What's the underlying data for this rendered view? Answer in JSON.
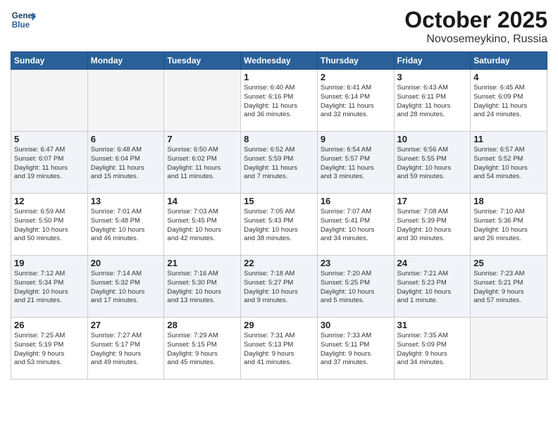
{
  "header": {
    "logo_line1": "General",
    "logo_line2": "Blue",
    "month": "October 2025",
    "location": "Novosemeykino, Russia"
  },
  "weekdays": [
    "Sunday",
    "Monday",
    "Tuesday",
    "Wednesday",
    "Thursday",
    "Friday",
    "Saturday"
  ],
  "weeks": [
    {
      "shaded": false,
      "days": [
        {
          "num": "",
          "info": ""
        },
        {
          "num": "",
          "info": ""
        },
        {
          "num": "",
          "info": ""
        },
        {
          "num": "1",
          "info": "Sunrise: 6:40 AM\nSunset: 6:16 PM\nDaylight: 11 hours\nand 36 minutes."
        },
        {
          "num": "2",
          "info": "Sunrise: 6:41 AM\nSunset: 6:14 PM\nDaylight: 11 hours\nand 32 minutes."
        },
        {
          "num": "3",
          "info": "Sunrise: 6:43 AM\nSunset: 6:11 PM\nDaylight: 11 hours\nand 28 minutes."
        },
        {
          "num": "4",
          "info": "Sunrise: 6:45 AM\nSunset: 6:09 PM\nDaylight: 11 hours\nand 24 minutes."
        }
      ]
    },
    {
      "shaded": true,
      "days": [
        {
          "num": "5",
          "info": "Sunrise: 6:47 AM\nSunset: 6:07 PM\nDaylight: 11 hours\nand 19 minutes."
        },
        {
          "num": "6",
          "info": "Sunrise: 6:48 AM\nSunset: 6:04 PM\nDaylight: 11 hours\nand 15 minutes."
        },
        {
          "num": "7",
          "info": "Sunrise: 6:50 AM\nSunset: 6:02 PM\nDaylight: 11 hours\nand 11 minutes."
        },
        {
          "num": "8",
          "info": "Sunrise: 6:52 AM\nSunset: 5:59 PM\nDaylight: 11 hours\nand 7 minutes."
        },
        {
          "num": "9",
          "info": "Sunrise: 6:54 AM\nSunset: 5:57 PM\nDaylight: 11 hours\nand 3 minutes."
        },
        {
          "num": "10",
          "info": "Sunrise: 6:56 AM\nSunset: 5:55 PM\nDaylight: 10 hours\nand 59 minutes."
        },
        {
          "num": "11",
          "info": "Sunrise: 6:57 AM\nSunset: 5:52 PM\nDaylight: 10 hours\nand 54 minutes."
        }
      ]
    },
    {
      "shaded": false,
      "days": [
        {
          "num": "12",
          "info": "Sunrise: 6:59 AM\nSunset: 5:50 PM\nDaylight: 10 hours\nand 50 minutes."
        },
        {
          "num": "13",
          "info": "Sunrise: 7:01 AM\nSunset: 5:48 PM\nDaylight: 10 hours\nand 46 minutes."
        },
        {
          "num": "14",
          "info": "Sunrise: 7:03 AM\nSunset: 5:45 PM\nDaylight: 10 hours\nand 42 minutes."
        },
        {
          "num": "15",
          "info": "Sunrise: 7:05 AM\nSunset: 5:43 PM\nDaylight: 10 hours\nand 38 minutes."
        },
        {
          "num": "16",
          "info": "Sunrise: 7:07 AM\nSunset: 5:41 PM\nDaylight: 10 hours\nand 34 minutes."
        },
        {
          "num": "17",
          "info": "Sunrise: 7:08 AM\nSunset: 5:39 PM\nDaylight: 10 hours\nand 30 minutes."
        },
        {
          "num": "18",
          "info": "Sunrise: 7:10 AM\nSunset: 5:36 PM\nDaylight: 10 hours\nand 26 minutes."
        }
      ]
    },
    {
      "shaded": true,
      "days": [
        {
          "num": "19",
          "info": "Sunrise: 7:12 AM\nSunset: 5:34 PM\nDaylight: 10 hours\nand 21 minutes."
        },
        {
          "num": "20",
          "info": "Sunrise: 7:14 AM\nSunset: 5:32 PM\nDaylight: 10 hours\nand 17 minutes."
        },
        {
          "num": "21",
          "info": "Sunrise: 7:16 AM\nSunset: 5:30 PM\nDaylight: 10 hours\nand 13 minutes."
        },
        {
          "num": "22",
          "info": "Sunrise: 7:18 AM\nSunset: 5:27 PM\nDaylight: 10 hours\nand 9 minutes."
        },
        {
          "num": "23",
          "info": "Sunrise: 7:20 AM\nSunset: 5:25 PM\nDaylight: 10 hours\nand 5 minutes."
        },
        {
          "num": "24",
          "info": "Sunrise: 7:21 AM\nSunset: 5:23 PM\nDaylight: 10 hours\nand 1 minute."
        },
        {
          "num": "25",
          "info": "Sunrise: 7:23 AM\nSunset: 5:21 PM\nDaylight: 9 hours\nand 57 minutes."
        }
      ]
    },
    {
      "shaded": false,
      "days": [
        {
          "num": "26",
          "info": "Sunrise: 7:25 AM\nSunset: 5:19 PM\nDaylight: 9 hours\nand 53 minutes."
        },
        {
          "num": "27",
          "info": "Sunrise: 7:27 AM\nSunset: 5:17 PM\nDaylight: 9 hours\nand 49 minutes."
        },
        {
          "num": "28",
          "info": "Sunrise: 7:29 AM\nSunset: 5:15 PM\nDaylight: 9 hours\nand 45 minutes."
        },
        {
          "num": "29",
          "info": "Sunrise: 7:31 AM\nSunset: 5:13 PM\nDaylight: 9 hours\nand 41 minutes."
        },
        {
          "num": "30",
          "info": "Sunrise: 7:33 AM\nSunset: 5:11 PM\nDaylight: 9 hours\nand 37 minutes."
        },
        {
          "num": "31",
          "info": "Sunrise: 7:35 AM\nSunset: 5:09 PM\nDaylight: 9 hours\nand 34 minutes."
        },
        {
          "num": "",
          "info": ""
        }
      ]
    }
  ]
}
